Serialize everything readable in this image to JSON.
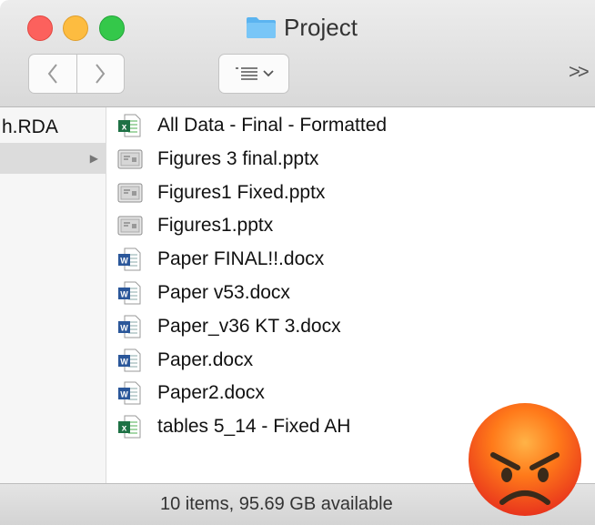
{
  "window": {
    "title": "Project"
  },
  "toolbar": {
    "back": "<",
    "forward": ">",
    "view_caret": "⌄",
    "overflow": ">>"
  },
  "sidebar": {
    "items": [
      {
        "label": "h.RDA",
        "selected": false
      },
      {
        "label": "",
        "selected": true
      }
    ]
  },
  "files": [
    {
      "name": "All Data - Final - Formatted",
      "type": "xlsx",
      "icon": "excel-icon"
    },
    {
      "name": "Figures 3 final.pptx",
      "type": "pptx",
      "icon": "presentation-icon"
    },
    {
      "name": "Figures1 Fixed.pptx",
      "type": "pptx",
      "icon": "presentation-icon"
    },
    {
      "name": "Figures1.pptx",
      "type": "pptx",
      "icon": "presentation-icon"
    },
    {
      "name": "Paper FINAL!!.docx",
      "type": "docx",
      "icon": "word-icon"
    },
    {
      "name": "Paper v53.docx",
      "type": "docx",
      "icon": "word-icon"
    },
    {
      "name": "Paper_v36 KT 3.docx",
      "type": "docx",
      "icon": "word-icon"
    },
    {
      "name": "Paper.docx",
      "type": "docx",
      "icon": "word-icon"
    },
    {
      "name": "Paper2.docx",
      "type": "docx",
      "icon": "word-icon"
    },
    {
      "name": "tables 5_14 - Fixed AH",
      "type": "xlsx",
      "icon": "excel-icon"
    }
  ],
  "status": {
    "text": "10 items, 95.69 GB available"
  },
  "overlay": {
    "icon": "angry-face-icon"
  },
  "colors": {
    "close": "#fc615d",
    "minimize": "#fdbc40",
    "zoom": "#34c84a",
    "folder": "#5bb4f0",
    "excel": "#1e7145",
    "word": "#2b579a"
  }
}
